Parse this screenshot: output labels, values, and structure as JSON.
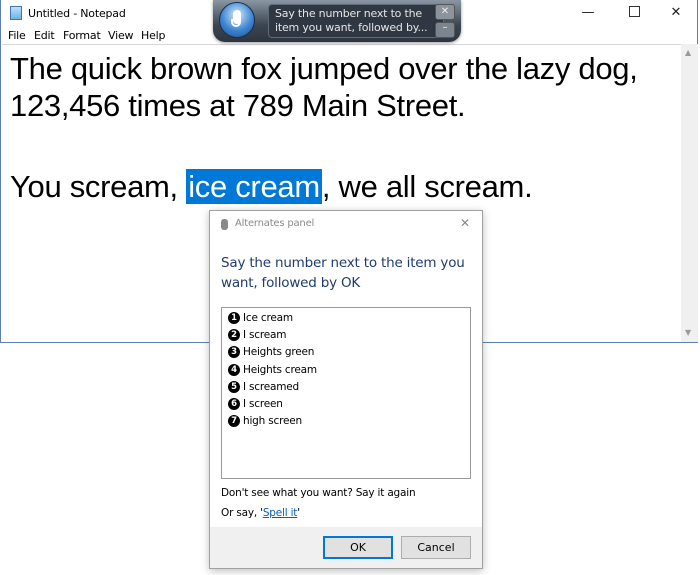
{
  "window": {
    "title": "Untitled - Notepad",
    "minimize_glyph": "—",
    "close_glyph": "✕"
  },
  "menu": [
    "File",
    "Edit",
    "Format",
    "View",
    "Help"
  ],
  "document": {
    "line1": "The quick brown fox jumped over the lazy dog,",
    "line2": "123,456 times at 789 Main Street.",
    "line3_before": "You scream, ",
    "line3_selected": "ice cream",
    "line3_after": ", we all scream."
  },
  "scrollbar": {
    "up": "▲",
    "down": "▼"
  },
  "speech_bar": {
    "message": "Say the number next to the\nitem you want, followed by...",
    "close_glyph": "✕",
    "minimize_glyph": "–"
  },
  "alternates_panel": {
    "title": "Alternates panel",
    "close_glyph": "✕",
    "heading": "Say the number next to the item you want, followed by OK",
    "items": [
      {
        "num": "1",
        "label": "Ice cream"
      },
      {
        "num": "2",
        "label": "I scream"
      },
      {
        "num": "3",
        "label": "Heights green"
      },
      {
        "num": "4",
        "label": "Heights cream"
      },
      {
        "num": "5",
        "label": "I screamed"
      },
      {
        "num": "6",
        "label": "I screen"
      },
      {
        "num": "7",
        "label": "high screen"
      }
    ],
    "hint": "Don't see what you want? Say it again",
    "spell_prefix": "Or say, '",
    "spell_link": "Spell it",
    "spell_suffix": "'",
    "ok_label": "OK",
    "cancel_label": "Cancel"
  },
  "colors": {
    "selection": "#0078d7",
    "heading": "#1e3d6e",
    "link": "#0a5bb5",
    "window_border": "#5d7fb5"
  },
  "icons": {
    "app": "notepad-icon",
    "mic": "microphone-icon",
    "dialog": "microphone-icon"
  }
}
